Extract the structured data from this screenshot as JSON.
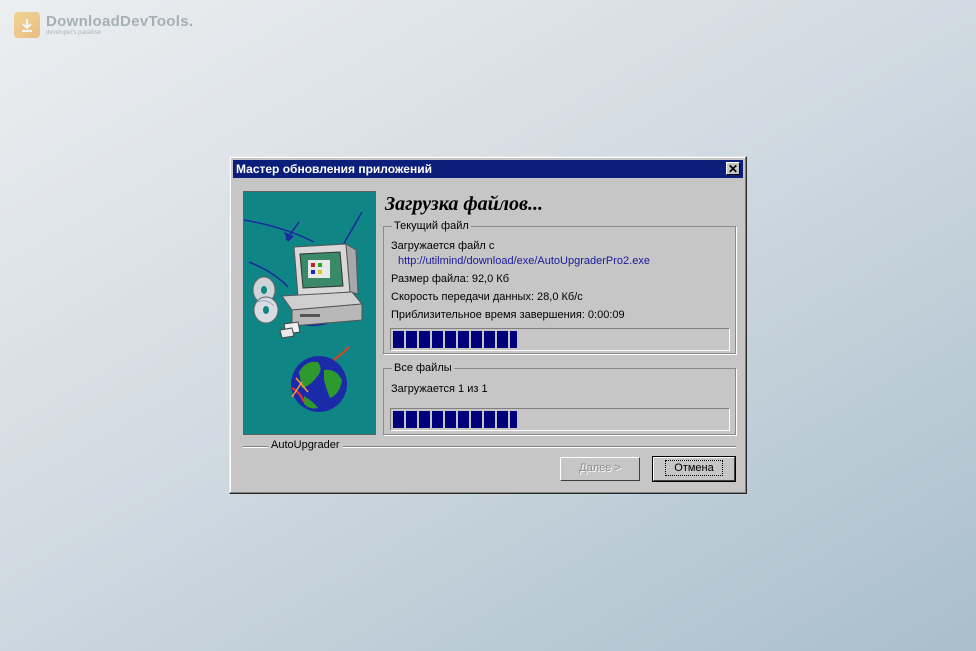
{
  "watermark": {
    "title": "DownloadDevTools.",
    "subtitle": "developer's paradise"
  },
  "dialog": {
    "title": "Мастер обновления приложений",
    "close_symbol": "✕",
    "heading": "Загрузка файлов...",
    "current_file": {
      "legend": "Текущий файл",
      "downloading_label": "Загружается файл с",
      "url": "http://utilmind/download/exe/AutoUpgraderPro2.exe",
      "size": "Размер файла: 92,0 Кб",
      "speed": "Скорость передачи данных: 28,0 Кб/с",
      "eta": "Приблизительное время завершения: 0:00:09",
      "progress_percent": 37
    },
    "all_files": {
      "legend": "Все файлы",
      "status": "Загружается 1 из 1",
      "progress_percent": 37
    },
    "footer_label": "AutoUpgrader",
    "buttons": {
      "next": "Далее >",
      "cancel": "Отмена"
    }
  },
  "colors": {
    "titlebar": "#0a1e7a",
    "progress": "#00007b",
    "dialog_face": "#c6c6c6",
    "illustration_bg": "#0f8585"
  },
  "icons": [
    "computer-illustration",
    "cd-disc-icon",
    "globe-icon",
    "close-icon"
  ]
}
